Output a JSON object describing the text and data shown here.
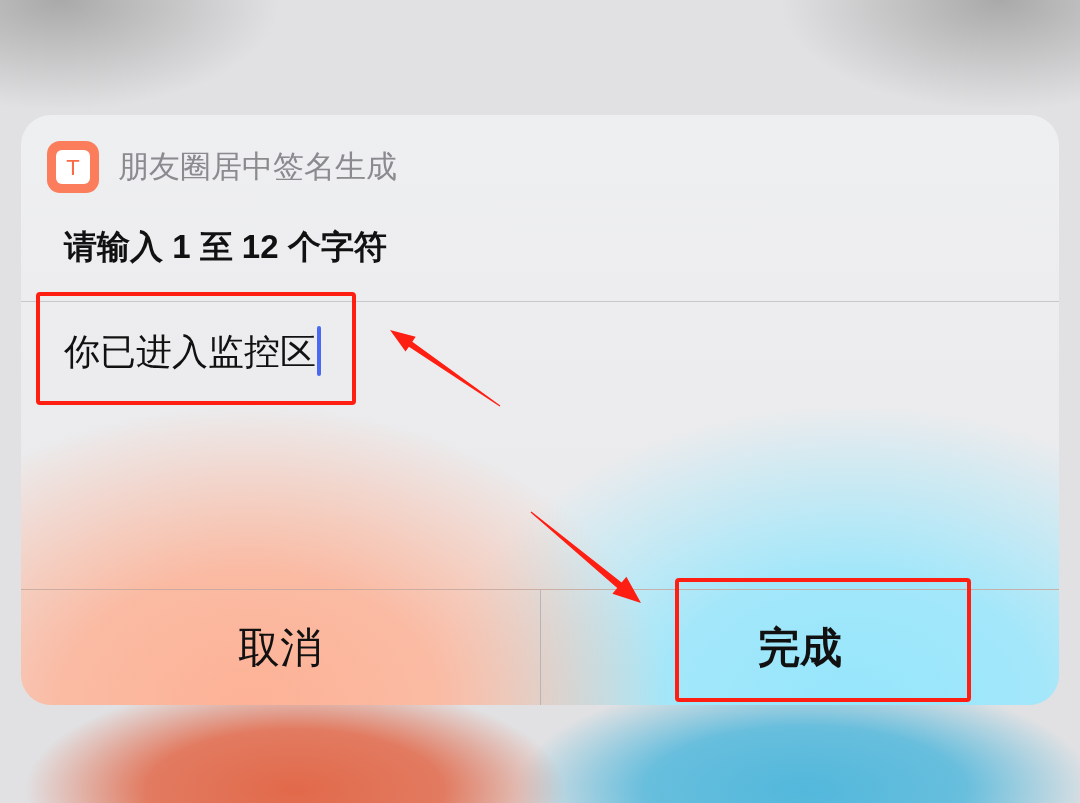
{
  "dialog": {
    "app": {
      "icon_letter": "T",
      "title": "朋友圈居中签名生成"
    },
    "prompt": "请输入 1 至 12 个字符",
    "input": {
      "value": "你已进入监控区",
      "focused": true,
      "highlighted": true
    },
    "buttons": [
      {
        "label": "取消",
        "primary": false,
        "highlighted": false
      },
      {
        "label": "完成",
        "primary": true,
        "highlighted": true
      }
    ]
  }
}
